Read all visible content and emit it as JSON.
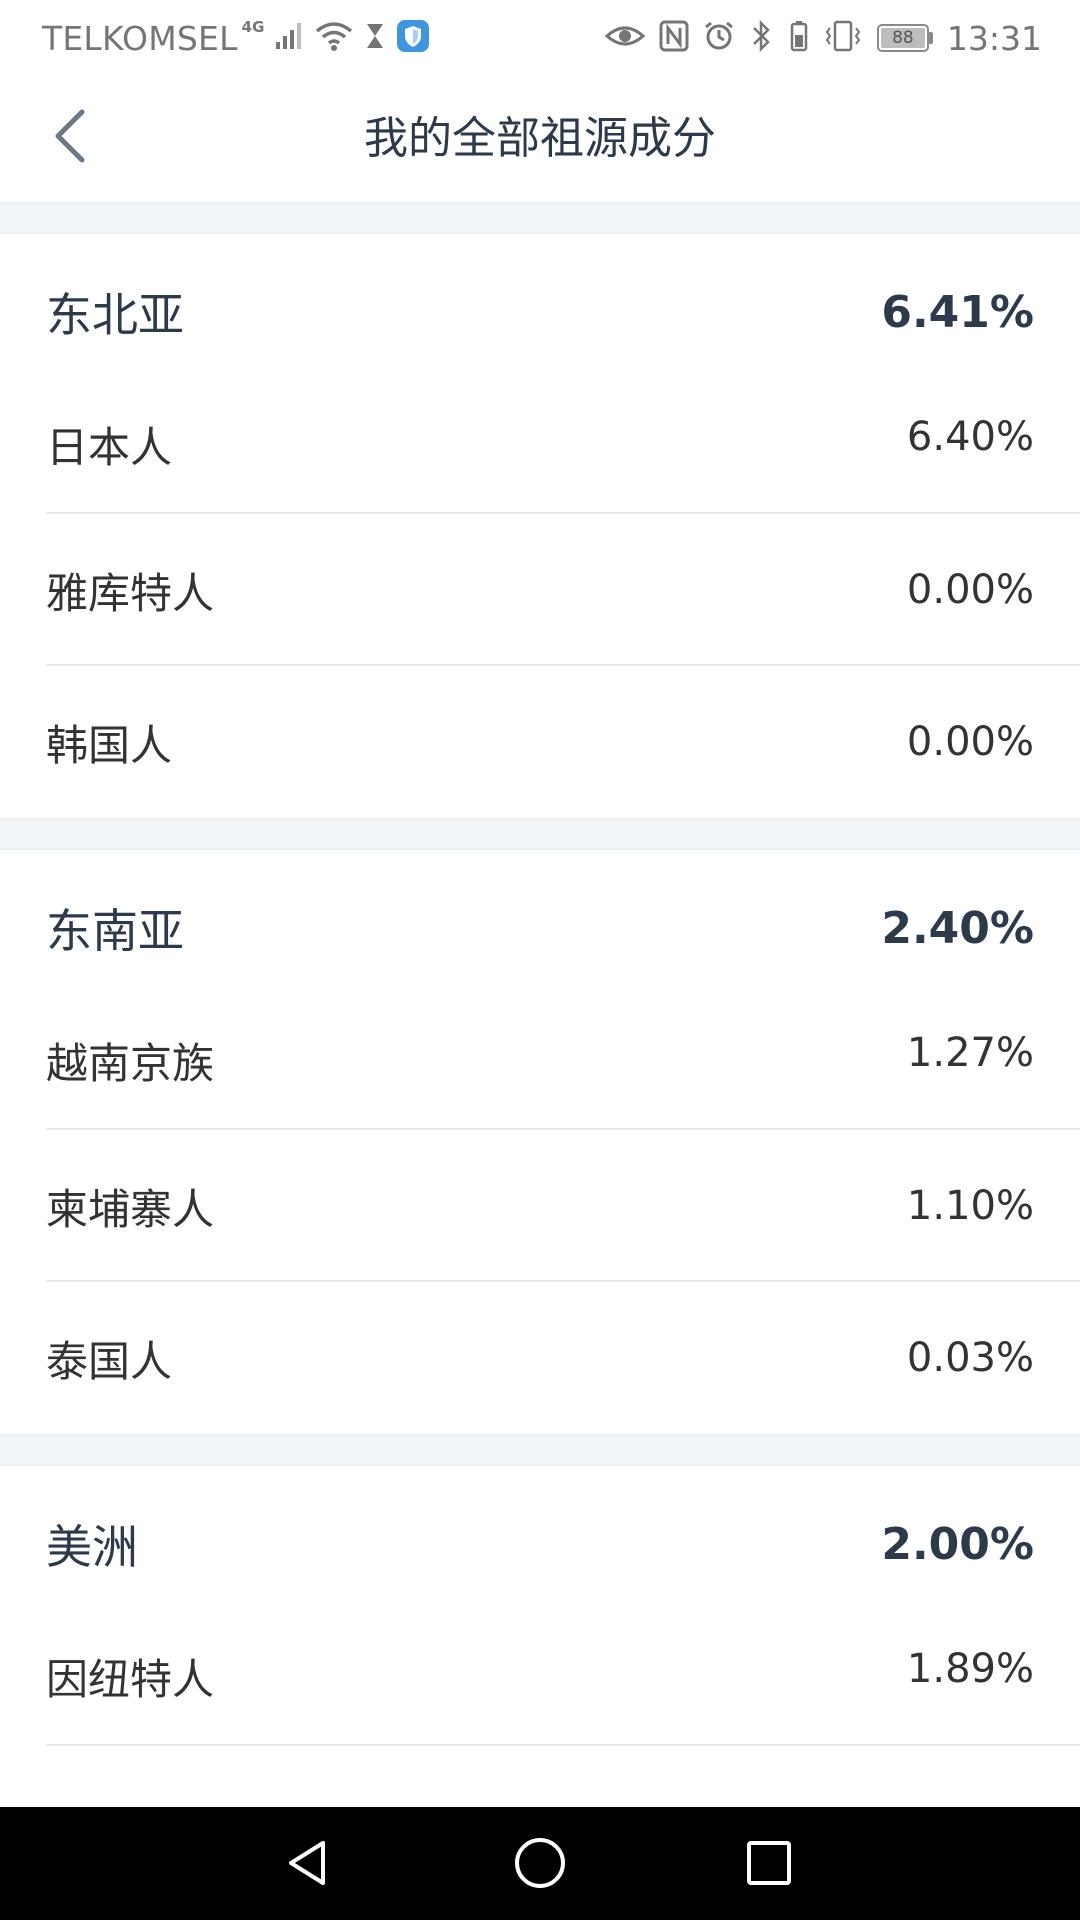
{
  "status_bar": {
    "carrier": "TELKOMSEL",
    "network_type": "4G",
    "battery_level": "88",
    "time": "13:31",
    "icons": [
      "signal-icon",
      "wifi-icon",
      "hourglass-icon",
      "shield-app-icon",
      "eye-icon",
      "nfc-icon",
      "alarm-icon",
      "bluetooth-icon",
      "vibrate-icon",
      "battery-icon"
    ]
  },
  "header": {
    "title": "我的全部祖源成分",
    "back_icon": "chevron-left-icon"
  },
  "groups": [
    {
      "region": "东北亚",
      "value": "6.41%",
      "populations": [
        {
          "name": "日本人",
          "value": "6.40%"
        },
        {
          "name": "雅库特人",
          "value": "0.00%"
        },
        {
          "name": "韩国人",
          "value": "0.00%"
        }
      ]
    },
    {
      "region": "东南亚",
      "value": "2.40%",
      "populations": [
        {
          "name": "越南京族",
          "value": "1.27%"
        },
        {
          "name": "柬埔寨人",
          "value": "1.10%"
        },
        {
          "name": "泰国人",
          "value": "0.03%"
        }
      ]
    },
    {
      "region": "美洲",
      "value": "2.00%",
      "populations": [
        {
          "name": "因纽特人",
          "value": "1.89%"
        }
      ]
    }
  ],
  "nav_bar": {
    "icons": [
      "back-triangle-icon",
      "home-circle-icon",
      "recents-square-icon"
    ]
  },
  "colors": {
    "title_text": "#2c3a4b",
    "body_text": "#333333",
    "section_gap": "#f2f5f8",
    "divider": "#e8e8e8",
    "nav_bar": "#000000"
  }
}
